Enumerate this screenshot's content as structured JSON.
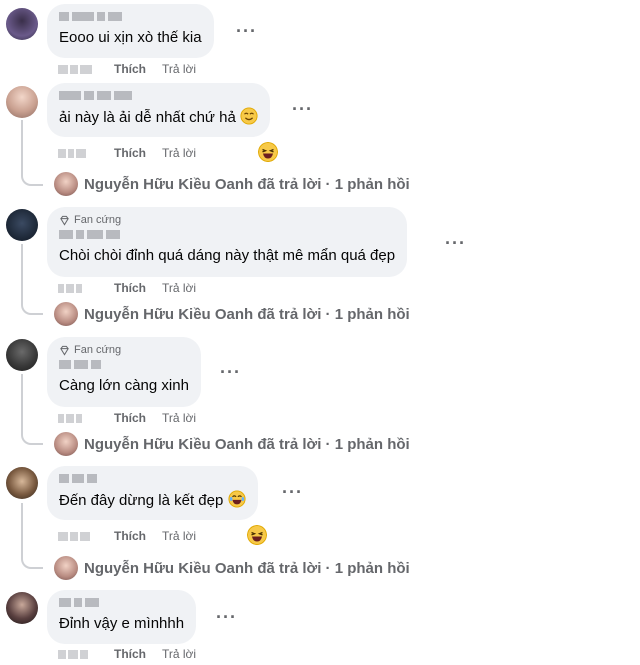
{
  "labels": {
    "like": "Thích",
    "reply": "Trả lời",
    "more": "···",
    "fan_badge": "Fan cứng"
  },
  "replies_summary": "Nguyễn Hữu Kiều Oanh đã trả lời · 1 phản hồi",
  "comments": [
    {
      "text": "Eooo ui xịn xò thế kia"
    },
    {
      "text": "ải này là ải dễ nhất chứ hả"
    },
    {
      "text": "Chòi chòi đỉnh quá dáng này thật mê mẩn quá đẹp"
    },
    {
      "text": "Càng lớn càng xinh"
    },
    {
      "text": "Đến đây dừng là kết đẹp"
    },
    {
      "text": "Đỉnh vậy e mìnhhh"
    }
  ],
  "icons": {
    "fan_badge": "diamond-icon",
    "reaction": "laughing-emoji-icon",
    "inline_emoji": "smiling-emoji-icon"
  },
  "colors": {
    "bubble": "#f0f2f5",
    "secondary_text": "#65676b",
    "thread_line": "#ced0d4"
  }
}
